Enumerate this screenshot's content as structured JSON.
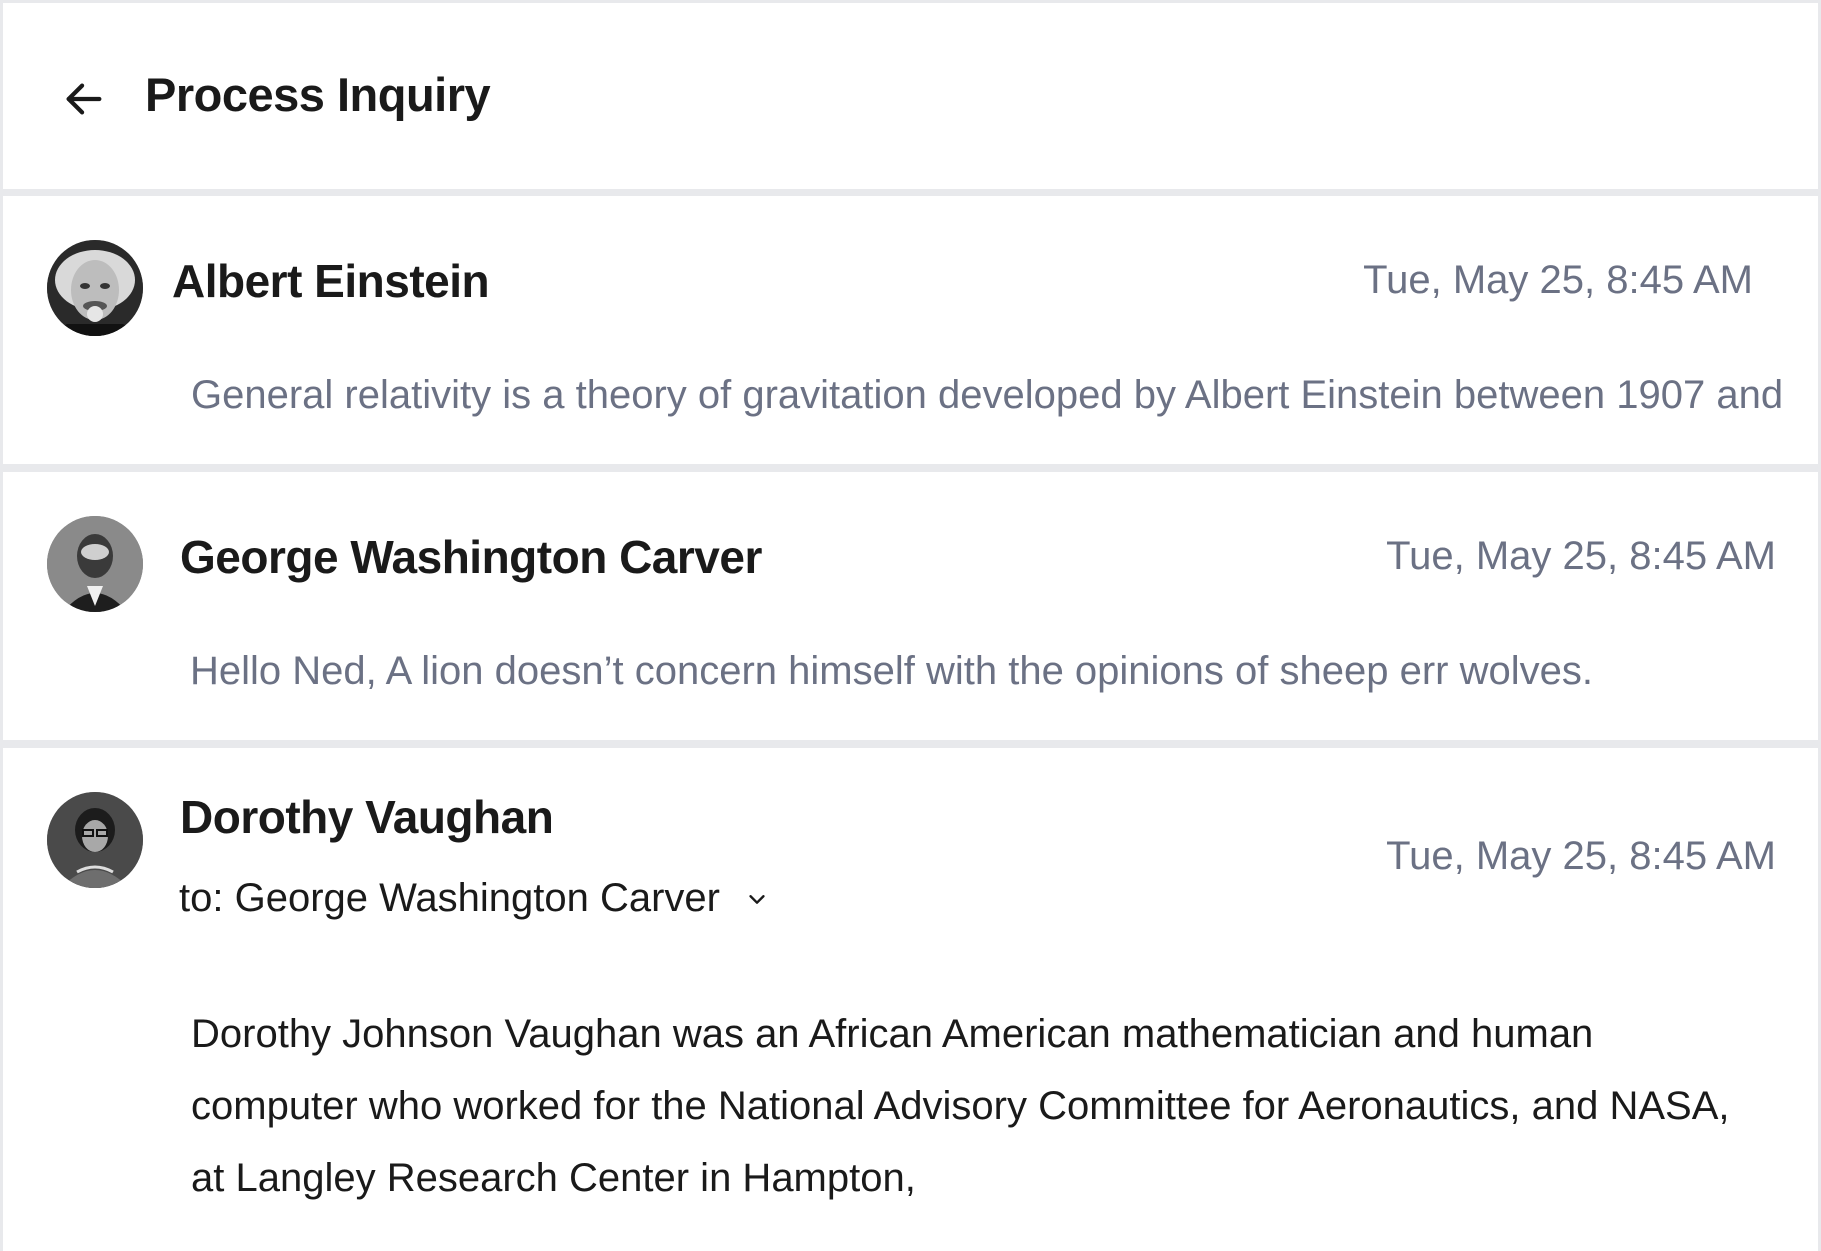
{
  "header": {
    "back_icon": "arrow-left-icon",
    "title": "Process Inquiry"
  },
  "messages": [
    {
      "sender": "Albert Einstein",
      "timestamp": "Tue, May 25, 8:45 AM",
      "preview": "General relativity is a theory of gravitation developed by Albert Einstein between 1907 and"
    },
    {
      "sender": "George Washington Carver",
      "timestamp": "Tue, May 25, 8:45 AM",
      "preview": "Hello Ned, A lion doesn’t concern himself with the opinions of sheep err wolves."
    },
    {
      "sender": "Dorothy Vaughan",
      "recipient": "to: George Washington Carver",
      "recipient_icon": "chevron-down-icon",
      "timestamp": "Tue, May 25, 8:45 AM",
      "body": "Dorothy Johnson Vaughan was an African American mathematician and human computer who worked for the National Advisory Committee for Aeronautics, and NASA, at Langley Research Center in Hampton,"
    }
  ]
}
